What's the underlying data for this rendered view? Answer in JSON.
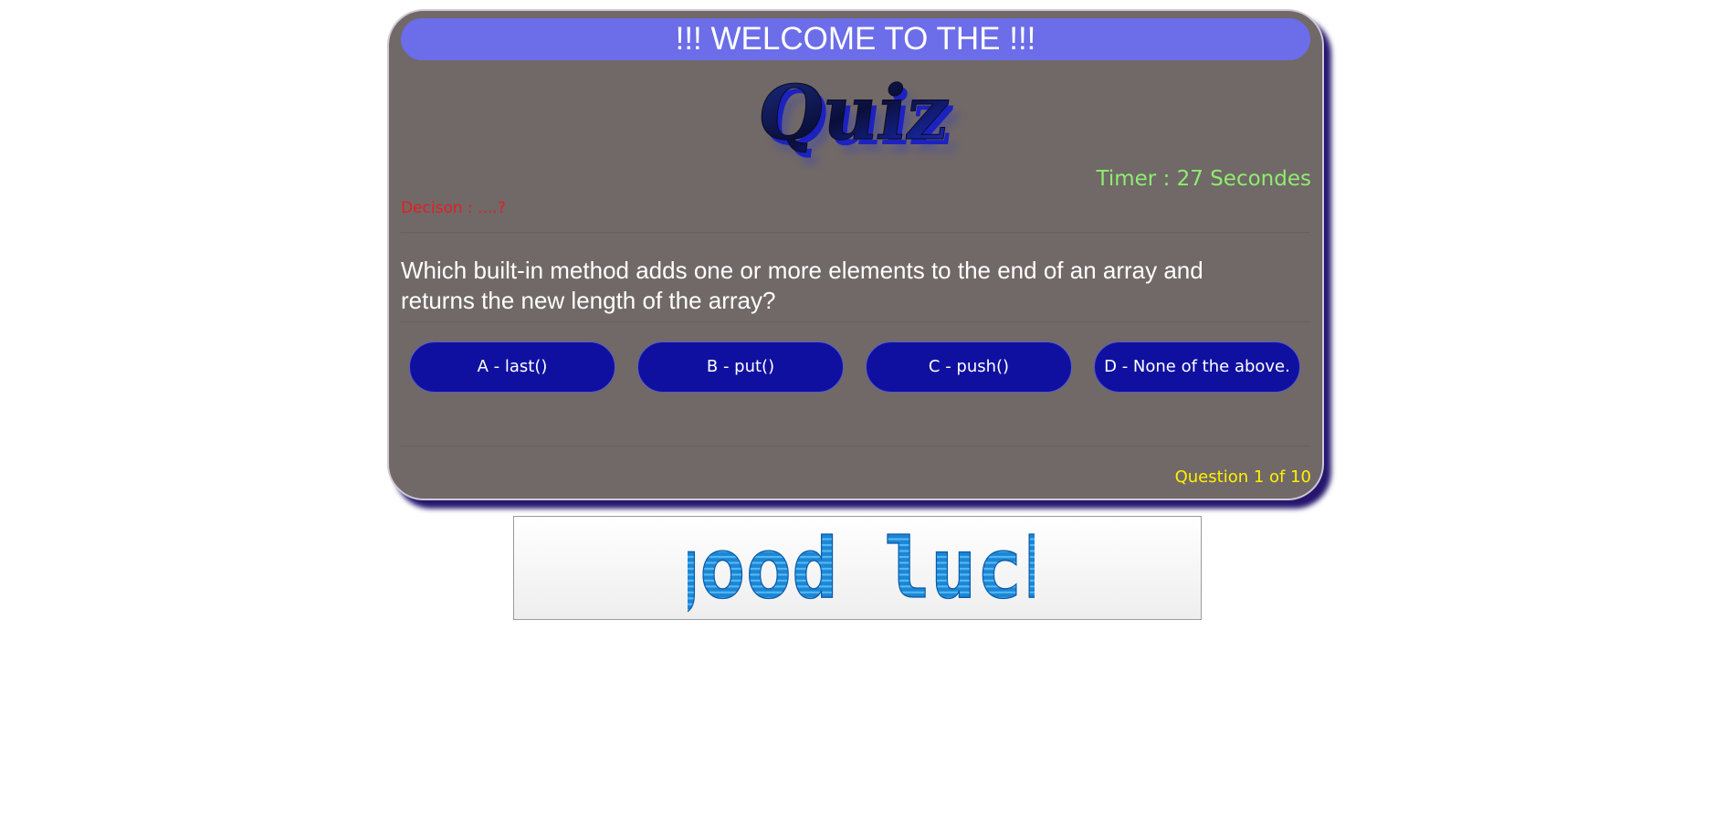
{
  "header": {
    "welcome_text": "!!! WELCOME TO THE !!!",
    "logo_text": "Quiz"
  },
  "status": {
    "timer_text": "Timer : 27 Secondes",
    "decision_text": "Decison : ....?"
  },
  "question": {
    "text": "Which built-in method adds one or more elements to the end of an array and returns the new length of the array?"
  },
  "options": [
    {
      "label": "A - last()"
    },
    {
      "label": "B - put()"
    },
    {
      "label": "C - push()"
    },
    {
      "label": "D - None of the above."
    }
  ],
  "footer": {
    "counter_text": "Question 1 of 10"
  },
  "banner": {
    "text": "good luck"
  },
  "colors": {
    "card_bg": "#716868",
    "welcome_bg": "#6b6de9",
    "option_bg": "#1010a0",
    "timer": "#8dee6f",
    "decision": "#e51e1e",
    "counter": "#fff200",
    "shadow": "#26176e"
  }
}
